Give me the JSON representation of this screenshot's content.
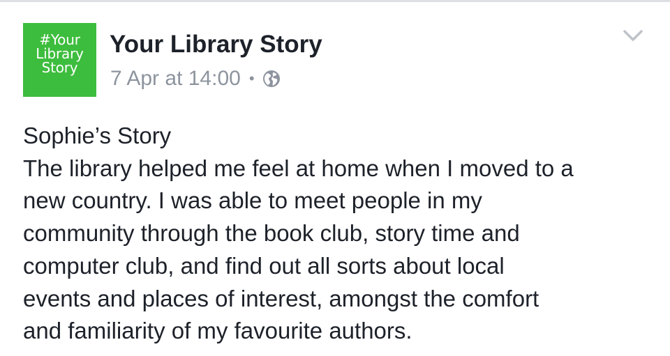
{
  "post": {
    "avatar": {
      "lines": [
        "#Your",
        "Library",
        "Story"
      ],
      "background_color": "#3dbd3d",
      "text_color": "#ffffff"
    },
    "author_name": "Your Library Story",
    "timestamp": "7 Apr at 14:00",
    "separator": "•",
    "privacy_icon": "globe-icon",
    "menu_icon": "chevron-down-icon",
    "body": {
      "title": "Sophie’s Story",
      "lines": [
        "The library helped me feel at home when I moved to a",
        "new country. I was able to meet people in my",
        "community through the book club, story time and",
        "computer club, and find out all sorts about local",
        "events and places of interest, amongst the comfort",
        "and familiarity of my favourite authors."
      ]
    }
  },
  "colors": {
    "text_primary": "#1d2129",
    "text_secondary": "#8d949e",
    "divider": "#dddfe2"
  }
}
